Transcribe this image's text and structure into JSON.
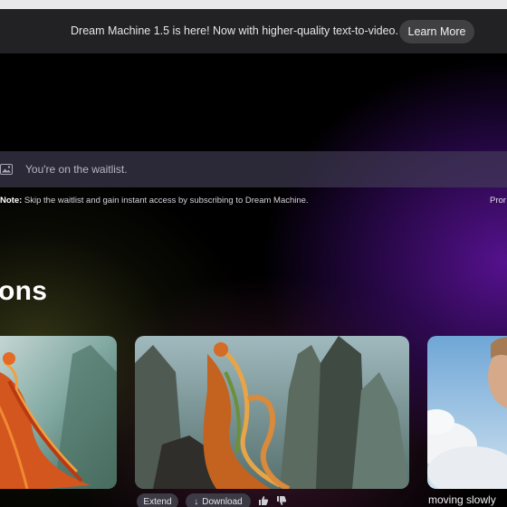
{
  "banner": {
    "message": "Dream Machine 1.5 is here! Now with higher-quality text-to-video.",
    "learn_more_label": "Learn More"
  },
  "prompt": {
    "status_text": "You're on the waitlist.",
    "icon": "image-icon"
  },
  "note": {
    "label": "Note:",
    "text": "Skip the waitlist and gain instant access by subscribing to Dream Machine.",
    "right_partial": "Pror"
  },
  "section": {
    "title_partial": "ons"
  },
  "cards": [
    {
      "id": "phoenix-bird-card",
      "actions": []
    },
    {
      "id": "phoenix-mountains-card",
      "actions": [
        "Extend",
        "Download"
      ]
    },
    {
      "id": "person-clouds-card",
      "caption": "moving slowly"
    }
  ],
  "card_actions": {
    "extend_label": "Extend",
    "download_label": "Download",
    "download_icon": "arrow-down-icon",
    "like_icon": "thumbs-up-icon",
    "dislike_icon": "thumbs-down-icon"
  },
  "right_caption": "moving slowly",
  "colors": {
    "background": "#000000",
    "banner_bg": "#222224",
    "button_bg": "#404043",
    "purple_glow": "#5a1296",
    "chip_bg": "#3c3a44"
  }
}
